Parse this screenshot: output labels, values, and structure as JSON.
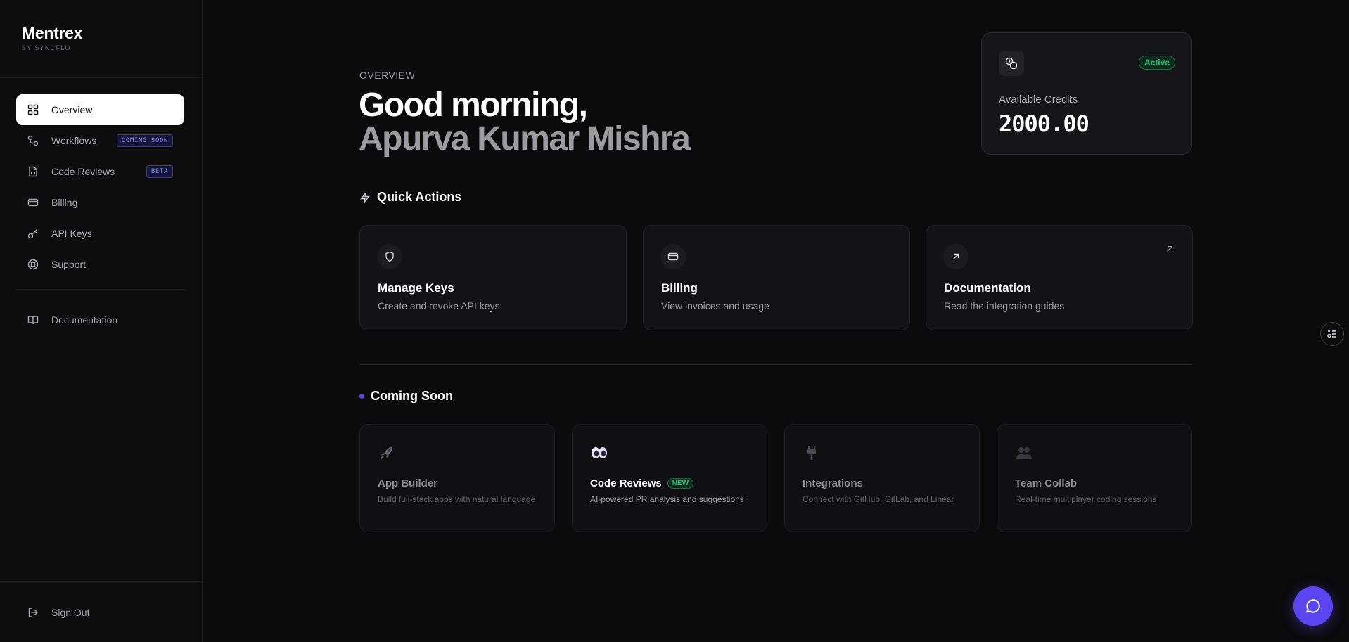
{
  "brand": {
    "name": "Mentrex",
    "sub": "BY SYNCFLO"
  },
  "sidebar": {
    "items": [
      {
        "label": "Overview",
        "icon": "grid-icon",
        "active": true
      },
      {
        "label": "Workflows",
        "icon": "workflow-icon",
        "badge": "COMING SOON"
      },
      {
        "label": "Code Reviews",
        "icon": "file-code-icon",
        "badge": "BETA"
      },
      {
        "label": "Billing",
        "icon": "credit-card-icon"
      },
      {
        "label": "API Keys",
        "icon": "key-icon"
      },
      {
        "label": "Support",
        "icon": "lifebuoy-icon"
      }
    ],
    "secondary": [
      {
        "label": "Documentation",
        "icon": "book-icon"
      }
    ],
    "signout": {
      "label": "Sign Out",
      "icon": "logout-icon"
    }
  },
  "header": {
    "eyebrow": "OVERVIEW",
    "greeting": "Good morning,",
    "user_name": "Apurva Kumar Mishra"
  },
  "credits": {
    "status": "Active",
    "label": "Available Credits",
    "value": "2000.00",
    "status_color": "#22c47a"
  },
  "quick_actions": {
    "title": "Quick Actions",
    "cards": [
      {
        "title": "Manage Keys",
        "desc": "Create and revoke API keys",
        "icon": "shield-icon"
      },
      {
        "title": "Billing",
        "desc": "View invoices and usage",
        "icon": "credit-card-icon"
      },
      {
        "title": "Documentation",
        "desc": "Read the integration guides",
        "icon": "arrow-up-right-icon"
      }
    ]
  },
  "coming_soon": {
    "title": "Coming Soon",
    "dot_color": "#4f46e5",
    "cards": [
      {
        "title": "App Builder",
        "desc": "Build full-stack apps with natural language",
        "icon": "rocket-icon"
      },
      {
        "title": "Code Reviews",
        "desc": "AI-powered PR analysis and suggestions",
        "icon": "eyes-icon",
        "badge": "NEW"
      },
      {
        "title": "Integrations",
        "desc": "Connect with GitHub, GitLab, and Linear",
        "icon": "plug-icon"
      },
      {
        "title": "Team Collab",
        "desc": "Real-time multiplayer coding sessions",
        "icon": "people-icon"
      }
    ]
  },
  "accent_color": "#5b45f0"
}
